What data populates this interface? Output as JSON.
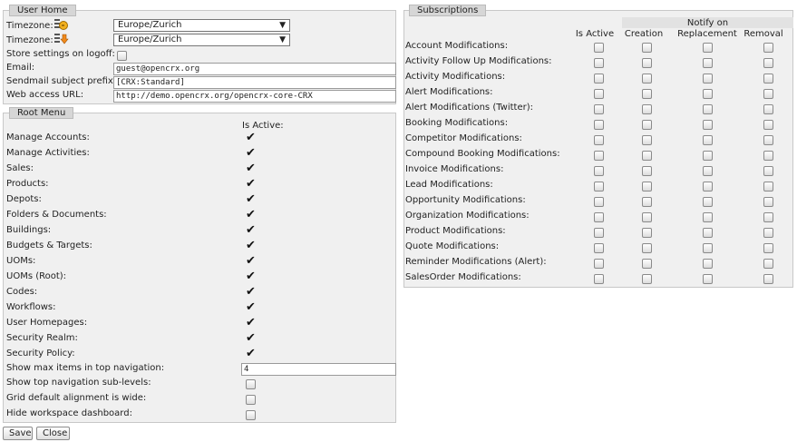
{
  "user_home": {
    "title": "User Home",
    "timezone_label_1": "Timezone:",
    "timezone_value_1": "Europe/Zurich",
    "timezone_label_2": "Timezone:",
    "timezone_value_2": "Europe/Zurich",
    "store_settings_label": "Store settings on logoff:",
    "email_label": "Email:",
    "email_value": "guest@opencrx.org",
    "sendmail_label": "Sendmail subject prefix:",
    "sendmail_value": "[CRX:Standard]",
    "web_access_label": "Web access URL:",
    "web_access_value": "http://demo.opencrx.org/opencrx-core-CRX"
  },
  "root_menu": {
    "title": "Root Menu",
    "is_active_header": "Is Active:",
    "items": [
      {
        "label": "Manage Accounts:",
        "checked": true
      },
      {
        "label": "Manage Activities:",
        "checked": true
      },
      {
        "label": "Sales:",
        "checked": true
      },
      {
        "label": "Products:",
        "checked": true
      },
      {
        "label": "Depots:",
        "checked": true
      },
      {
        "label": "Folders & Documents:",
        "checked": true
      },
      {
        "label": "Buildings:",
        "checked": true
      },
      {
        "label": "Budgets & Targets:",
        "checked": true
      },
      {
        "label": "UOMs:",
        "checked": true
      },
      {
        "label": "UOMs (Root):",
        "checked": true
      },
      {
        "label": "Codes:",
        "checked": true
      },
      {
        "label": "Workflows:",
        "checked": true
      },
      {
        "label": "User Homepages:",
        "checked": true
      },
      {
        "label": "Security Realm:",
        "checked": true
      },
      {
        "label": "Security Policy:",
        "checked": true
      }
    ],
    "max_items_label": "Show max items in top navigation:",
    "max_items_value": "4",
    "sub_levels_label": "Show top navigation sub-levels:",
    "grid_alignment_label": "Grid default alignment is wide:",
    "hide_dashboard_label": "Hide workspace dashboard:"
  },
  "subscriptions": {
    "title": "Subscriptions",
    "notify_on_header": "Notify on",
    "col_is_active": "Is Active",
    "col_creation": "Creation",
    "col_replacement": "Replacement",
    "col_removal": "Removal",
    "rows": [
      "Account Modifications:",
      "Activity Follow Up Modifications:",
      "Activity Modifications:",
      "Alert Modifications:",
      "Alert Modifications (Twitter):",
      "Booking Modifications:",
      "Competitor Modifications:",
      "Compound Booking Modifications:",
      "Invoice Modifications:",
      "Lead Modifications:",
      "Opportunity Modifications:",
      "Organization Modifications:",
      "Product Modifications:",
      "Quote Modifications:",
      "Reminder Modifications (Alert):",
      "SalesOrder Modifications:"
    ]
  },
  "buttons": {
    "save": "Save",
    "close": "Close"
  }
}
